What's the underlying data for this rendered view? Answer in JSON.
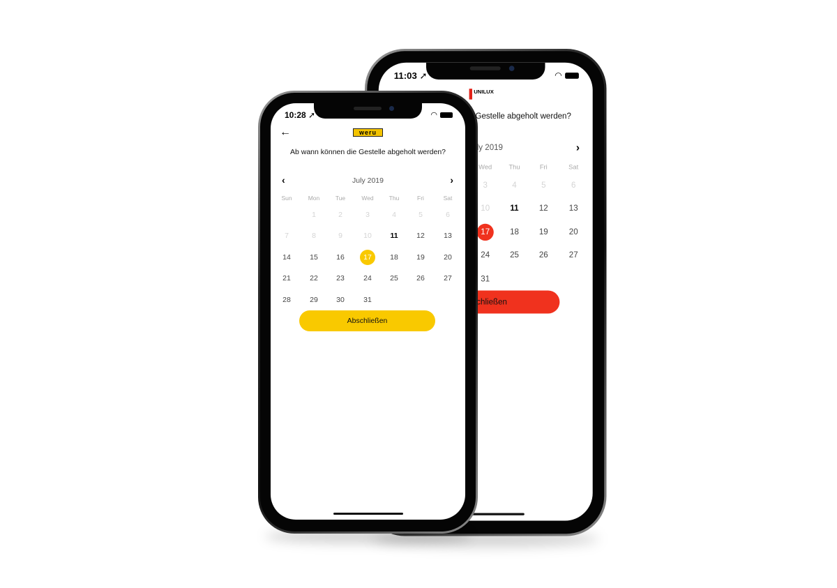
{
  "calendar": {
    "weekdays": [
      "Sun",
      "Mon",
      "Tue",
      "Wed",
      "Thu",
      "Fri",
      "Sat"
    ],
    "weeks": [
      [
        null,
        1,
        2,
        3,
        4,
        5,
        6
      ],
      [
        7,
        8,
        9,
        10,
        11,
        12,
        13
      ],
      [
        14,
        15,
        16,
        17,
        18,
        19,
        20
      ],
      [
        21,
        22,
        23,
        24,
        25,
        26,
        27
      ],
      [
        28,
        29,
        30,
        31,
        null,
        null,
        null
      ]
    ],
    "first_available_day": 11,
    "today": 11,
    "selected_day": 17
  },
  "phones": [
    {
      "brand": "unilux",
      "logo_text": "UNILUX",
      "time": "11:03",
      "accent": "#f0321e",
      "month": "July 2019",
      "title": "Ab wann können die Gestelle abgeholt werden?",
      "button": "Abschließen",
      "back_icon": "arrow-left-icon"
    },
    {
      "brand": "weru",
      "logo_text": "weru",
      "time": "10:28",
      "accent": "#f9c900",
      "month": "July 2019",
      "title": "Ab wann können die Gestelle abgeholt werden?",
      "button": "Abschließen",
      "back_icon": "arrow-left-icon"
    }
  ]
}
